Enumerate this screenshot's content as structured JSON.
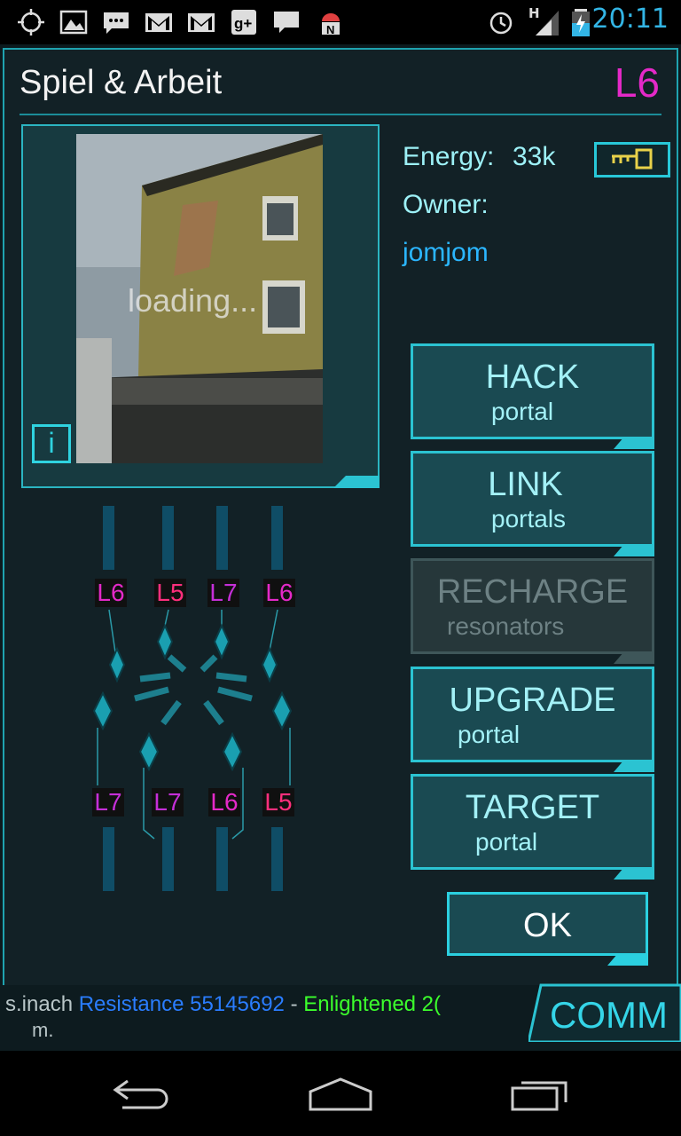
{
  "status_bar": {
    "time": "20:11",
    "left_icons": [
      "crosshair-icon",
      "image-icon",
      "messaging-icon",
      "gmail-icon",
      "gmail-icon",
      "google-plus-icon",
      "chat-icon",
      "android-icon"
    ],
    "right_icons": [
      "alarm-icon",
      "signal-icon",
      "battery-icon"
    ],
    "signal_label": "H"
  },
  "portal": {
    "name": "Spiel & Arbeit",
    "level": "L6",
    "energy_label": "Energy:",
    "energy_value": "33k",
    "owner_label": "Owner:",
    "owner_name": "jomjom",
    "image_loading_text": "loading...",
    "info_label": "i"
  },
  "resonators": {
    "top": [
      "L6",
      "L5",
      "L7",
      "L6"
    ],
    "bottom": [
      "L7",
      "L7",
      "L6",
      "L5"
    ]
  },
  "actions": [
    {
      "title": "HACK",
      "subtitle": "portal",
      "enabled": true
    },
    {
      "title": "LINK",
      "subtitle": "portals",
      "enabled": true
    },
    {
      "title": "RECHARGE",
      "subtitle": "resonators",
      "enabled": false
    },
    {
      "title": "UPGRADE",
      "subtitle": "portal",
      "enabled": true
    },
    {
      "title": "TARGET",
      "subtitle": "portal",
      "enabled": true
    }
  ],
  "ok_label": "OK",
  "comm": {
    "tab_label": "COMM",
    "line1_prefix": "s.inach",
    "line1_resistance": "Resistance 55145692",
    "line1_sep": " - ",
    "line1_enlightened": "Enlightened 2(",
    "line2": "m."
  },
  "colors": {
    "accent": "#2bc3d2",
    "level_magenta": "#e429c8",
    "owner_blue": "#2bb6ff",
    "resistance_blue": "#2a7dff",
    "enlightened_green": "#3cff2c"
  },
  "nav": [
    "back-icon",
    "home-icon",
    "recent-apps-icon"
  ]
}
